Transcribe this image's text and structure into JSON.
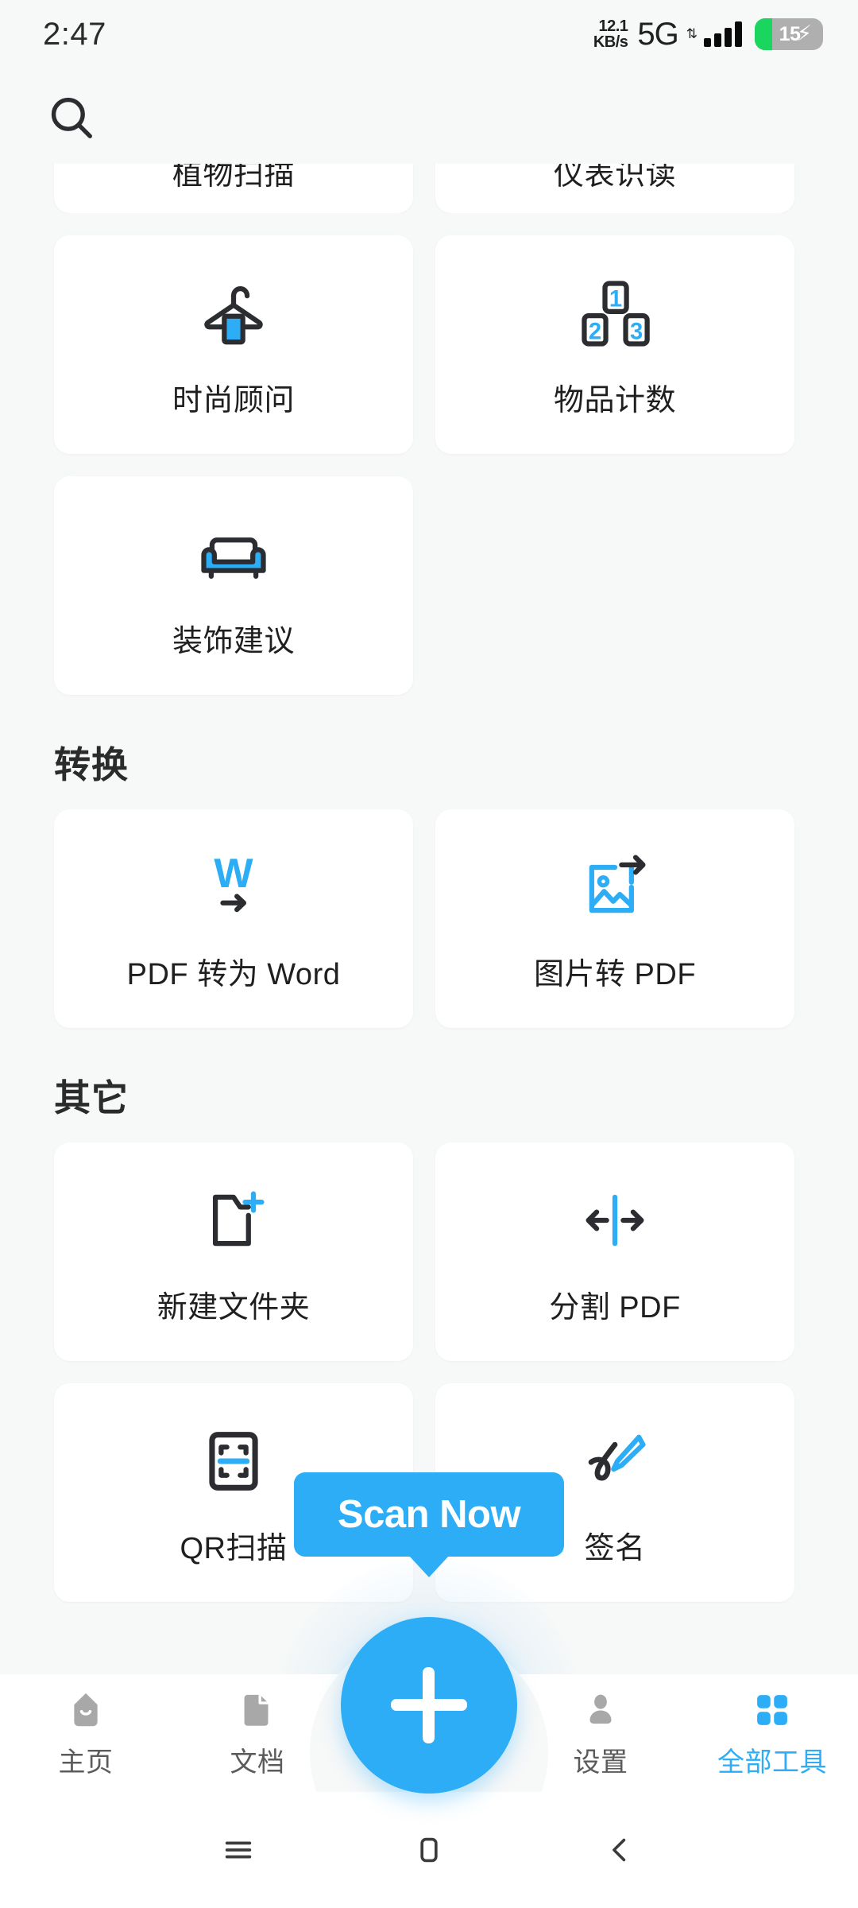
{
  "status_bar": {
    "clock": "2:47",
    "net_speed_value": "12.1",
    "net_speed_unit": "KB/s",
    "network": "5G",
    "data_arrows": "⇅",
    "battery_level": "15",
    "charging_glyph": "⚡"
  },
  "header": {
    "search_icon_name": "search-icon"
  },
  "sections": [
    {
      "id": "partial-top",
      "title": "",
      "clipped": true,
      "items": [
        {
          "label": "植物扫描",
          "icon": "plant-scan-icon"
        },
        {
          "label": "仪表识读",
          "icon": "meter-read-icon"
        }
      ]
    },
    {
      "id": "ai-tools",
      "title": "",
      "clipped": false,
      "items": [
        {
          "label": "时尚顾问",
          "icon": "clothes-hanger-icon"
        },
        {
          "label": "物品计数",
          "icon": "counting-blocks-icon"
        },
        {
          "label": "装饰建议",
          "icon": "sofa-icon"
        }
      ]
    },
    {
      "id": "convert",
      "title": "转换",
      "clipped": false,
      "items": [
        {
          "label": "PDF 转为 Word",
          "icon": "word-convert-icon"
        },
        {
          "label": "图片转 PDF",
          "icon": "image-to-pdf-icon"
        }
      ]
    },
    {
      "id": "other",
      "title": "其它",
      "clipped": false,
      "items": [
        {
          "label": "新建文件夹",
          "icon": "new-folder-icon"
        },
        {
          "label": "分割 PDF",
          "icon": "split-pdf-icon"
        },
        {
          "label": "QR扫描",
          "icon": "qr-scan-icon"
        },
        {
          "label": "签名",
          "icon": "signature-icon"
        }
      ]
    }
  ],
  "tooltip": {
    "text": "Scan Now"
  },
  "fab": {
    "label": "+",
    "icon": "plus-icon"
  },
  "bottom_nav": {
    "items": [
      {
        "label": "主页",
        "icon": "home-icon",
        "active": false
      },
      {
        "label": "文档",
        "icon": "document-icon",
        "active": false
      },
      {
        "label": "设置",
        "icon": "person-icon",
        "active": false
      },
      {
        "label": "全部工具",
        "icon": "grid-icon",
        "active": true
      }
    ]
  },
  "system_nav": {
    "recents": "recents-icon",
    "home": "home-square-icon",
    "back": "back-chevron-icon"
  },
  "colors": {
    "accent": "#2CADF6",
    "background": "#F7F8F8",
    "card": "#FFFFFF",
    "text_primary": "#1F1F1F",
    "text_muted": "#5B5B5B",
    "icon_dark": "#2B2D31",
    "battery_green": "#1BD65E"
  }
}
